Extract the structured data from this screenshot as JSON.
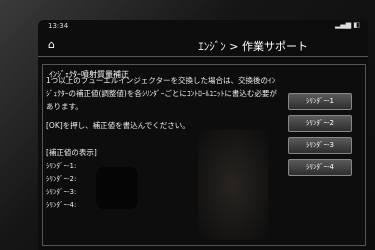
{
  "statusbar": {
    "time": "13:34"
  },
  "header": {
    "title": "ｴﾝｼﾞﾝ > 作業サポート"
  },
  "section": {
    "title": "ｲﾝｼﾞｪｸﾀｰ噴射質量補正",
    "instruction1": "1つ以上のフューエルインジェクターを交換した場合は、交換後のｲﾝｼﾞｪｸﾀｰの補正値(調整値)を各ｼﾘﾝﾀﾞｰごとにｺﾝﾄﾛｰﾙﾕﾆｯﾄに書込む必要があります。",
    "instruction2": "[OK]を押し、補正値を書込んでください。",
    "comp_title": "[補正値の表示]",
    "comp_rows": [
      "ｼﾘﾝﾀﾞｰ-1:",
      "ｼﾘﾝﾀﾞｰ-2:",
      "ｼﾘﾝﾀﾞｰ-3:",
      "ｼﾘﾝﾀﾞｰ-4:"
    ]
  },
  "buttons": [
    "ｼﾘﾝﾀﾞｰ-1",
    "ｼﾘﾝﾀﾞｰ-2",
    "ｼﾘﾝﾀﾞｰ-3",
    "ｼﾘﾝﾀﾞｰ-4"
  ]
}
